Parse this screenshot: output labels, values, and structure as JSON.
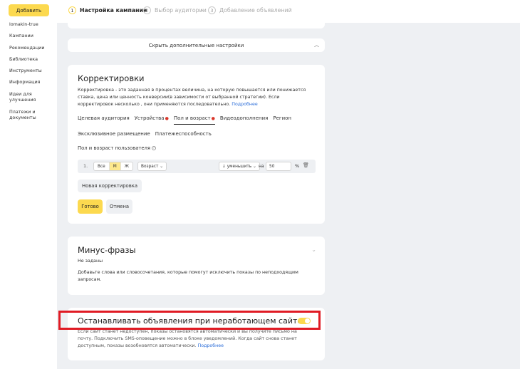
{
  "sidebar": {
    "add_button": "Добавить",
    "items": [
      "lomakin-true",
      "Кампании",
      "Рекомендации",
      "Библиотека",
      "Инструменты",
      "Информация",
      "Идеи для улучшения",
      "Платежи и документы"
    ]
  },
  "stepper": {
    "steps": [
      {
        "num": "1",
        "label": "Настройка кампании"
      },
      {
        "num": "2",
        "label": "Выбор аудитории"
      },
      {
        "num": "3",
        "label": "Добавление объявлений"
      }
    ]
  },
  "toggle_settings": {
    "label": "Скрыть дополнительные настройки"
  },
  "adjustments": {
    "title": "Корректировки",
    "description": "Корректировка - это заданная в процентах величина, на которую повышается или понижается ставка, цена или ценность конверсии(в зависимости от выбранной стратегии). Если корректировок несколько , они применяются последовательно.",
    "more_link": "Подробнее",
    "tabs_row1": [
      "Целевая аудитория",
      "Устройства",
      "Пол и возраст",
      "Видеодополнения",
      "Регион"
    ],
    "tabs_row2": [
      "Эксклюзивное размещение",
      "Платежеспособность"
    ],
    "section_title": "Пол и возраст пользователя",
    "rule": {
      "number": "1.",
      "gender_options": [
        "Все",
        "М",
        "Ж"
      ],
      "age_dropdown": "Возраст",
      "direction_dropdown": "↓ уменьшить",
      "on_label": "на",
      "value": "50",
      "percent": "%"
    },
    "new_button": "Новая корректировка",
    "done_button": "Готово",
    "cancel_button": "Отмена"
  },
  "minus_phrases": {
    "title": "Минус-фразы",
    "status": "Не заданы",
    "hint": "Добавьте слова или словосочетания, которые помогут исключить показы по неподходящим запросам."
  },
  "stop_ads": {
    "title": "Останавливать объявления при неработающем сайте",
    "description": "Если сайт станет недоступен, показы остановятся автоматически и вы получите письмо на почту. Подключить SMS-оповещение можно в блоке уведомлений. Когда сайт снова станет доступным, показы возобновятся автоматически.",
    "more_link": "Подробнее"
  },
  "colors": {
    "accent": "#fcd94f",
    "highlight": "#e01b24",
    "link": "#2a6cd8"
  }
}
